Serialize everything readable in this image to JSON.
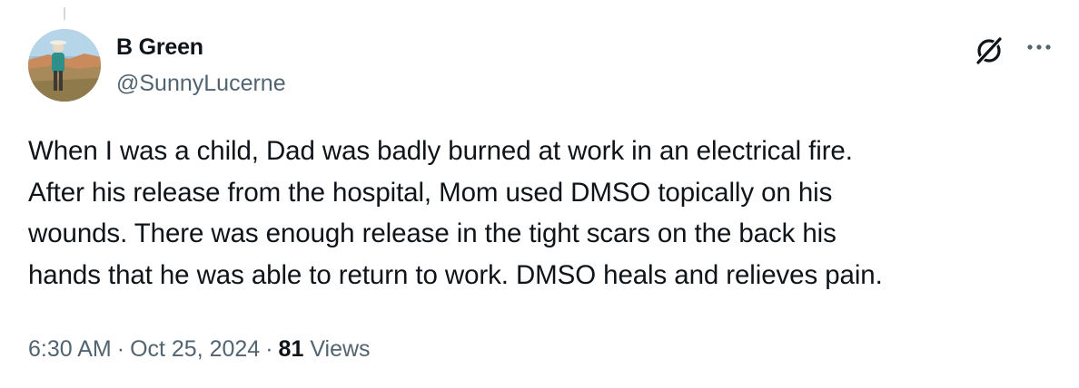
{
  "author": {
    "display_name": "B Green",
    "handle": "@SunnyLucerne"
  },
  "tweet": {
    "lines": [
      "When I was a child, Dad was badly burned at work in an electrical fire.",
      "After his release from the hospital, Mom used DMSO topically on his",
      "wounds. There was enough release in the tight scars on the back his",
      "hands that he was able to return to work. DMSO heals and relieves pain."
    ]
  },
  "meta": {
    "time": "6:30 AM",
    "separator": "·",
    "date": "Oct 25, 2024",
    "views_count": "81",
    "views_label": "Views"
  },
  "icons": {
    "grok": "grok-icon",
    "more": "more-options-icon"
  },
  "colors": {
    "primary_text": "#0f1419",
    "secondary_text": "#536471",
    "divider": "#cfd9de"
  }
}
